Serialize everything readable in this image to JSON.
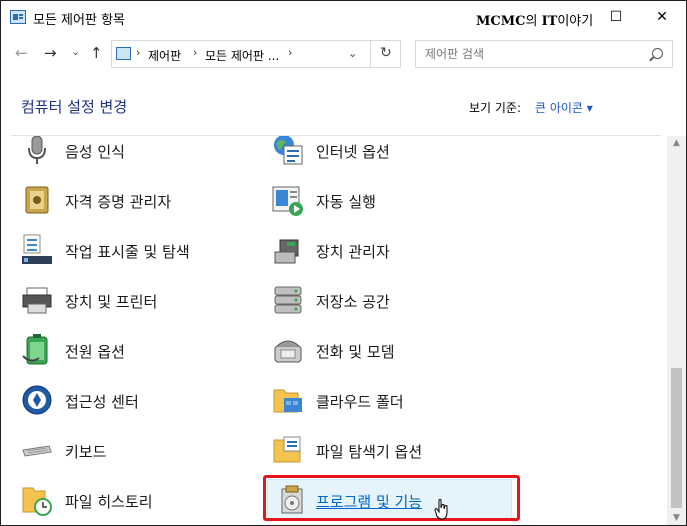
{
  "window": {
    "title": "모든 제어판 항목",
    "brand_prefix": "MCMC",
    "brand_mid": "의 ",
    "brand_it": "IT",
    "brand_suffix": "이야기",
    "btn_maximize": "☐",
    "btn_close": "✕"
  },
  "nav": {
    "back": "←",
    "forward": "→",
    "history": "⌄",
    "up": "↑"
  },
  "address": {
    "seg1": "제어판",
    "seg2": "모든 제어판 ...",
    "sep": "›",
    "dropdown": "⌄",
    "refresh": "↻"
  },
  "search": {
    "placeholder": "제어판 검색"
  },
  "header": {
    "title": "컴퓨터 설정 변경",
    "view_by_label": "보기 기준:",
    "view_by_value": "큰 아이콘 ▾"
  },
  "items": [
    {
      "label": "음성 인식",
      "icon": "microphone-icon"
    },
    {
      "label": "인터넷 옵션",
      "icon": "internet-options-icon"
    },
    {
      "label": "자격 증명 관리자",
      "icon": "credential-manager-icon"
    },
    {
      "label": "자동 실행",
      "icon": "autoplay-icon"
    },
    {
      "label": "작업 표시줄 및 탐색",
      "icon": "taskbar-icon"
    },
    {
      "label": "장치 관리자",
      "icon": "device-manager-icon"
    },
    {
      "label": "장치 및 프린터",
      "icon": "printer-icon"
    },
    {
      "label": "저장소 공간",
      "icon": "storage-spaces-icon"
    },
    {
      "label": "전원 옵션",
      "icon": "battery-icon"
    },
    {
      "label": "전화 및 모뎀",
      "icon": "phone-modem-icon"
    },
    {
      "label": "접근성 센터",
      "icon": "ease-of-access-icon"
    },
    {
      "label": "클라우드 폴더",
      "icon": "cloud-folder-icon"
    },
    {
      "label": "키보드",
      "icon": "keyboard-icon"
    },
    {
      "label": "파일 탐색기 옵션",
      "icon": "folder-options-icon"
    },
    {
      "label": "파일 히스토리",
      "icon": "file-history-icon"
    },
    {
      "label": "프로그램 및 기능",
      "icon": "programs-features-icon"
    }
  ],
  "colors": {
    "heading": "#1e3287",
    "link": "#1c56c4",
    "highlight_border": "#e8141c",
    "selected_bg": "#e5f3fb"
  }
}
